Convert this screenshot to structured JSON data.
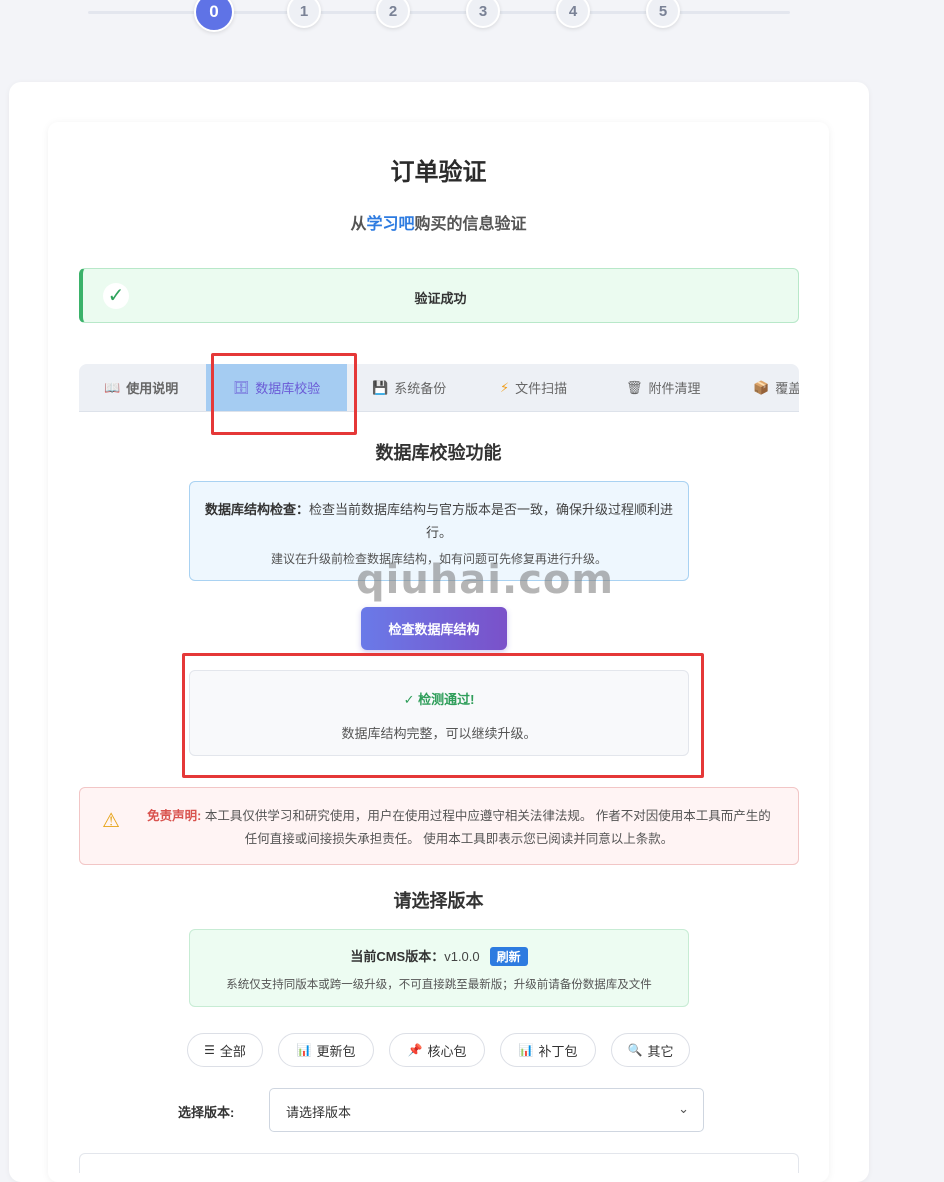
{
  "stepper": {
    "steps": [
      "0",
      "1",
      "2",
      "3",
      "4",
      "5"
    ],
    "active": 0
  },
  "header": {
    "title": "订单验证",
    "subtitle_prefix": "从",
    "subtitle_highlight": "学习吧",
    "subtitle_suffix": "购买的信息验证"
  },
  "success": {
    "icon": "✓",
    "text": "验证成功"
  },
  "tabs": [
    {
      "icon": "📖",
      "label": "使用说明"
    },
    {
      "icon": "🗄",
      "label": "数据库校验"
    },
    {
      "icon": "💾",
      "label": "系统备份"
    },
    {
      "icon": "⚡",
      "label": "文件扫描"
    },
    {
      "icon": "🗑",
      "label": "附件清理"
    },
    {
      "icon": "📦",
      "label": "覆盖"
    }
  ],
  "db_check": {
    "title": "数据库校验功能",
    "info_bold": "数据库结构检查：",
    "info_text": "检查当前数据库结构与官方版本是否一致，确保升级过程顺利进行。",
    "info_note": "建议在升级前检查数据库结构，如有问题可先修复再进行升级。",
    "button": "检查数据库结构",
    "result_title": "✓ 检测通过!",
    "result_text": "数据库结构完整，可以继续升级。"
  },
  "watermark": "qiuhai.com",
  "disclaimer": {
    "icon": "⚠",
    "label": "免责声明:",
    "text": "本工具仅供学习和研究使用，用户在使用过程中应遵守相关法律法规。 作者不对因使用本工具而产生的任何直接或间接损失承担责任。 使用本工具即表示您已阅读并同意以上条款。"
  },
  "version": {
    "title": "请选择版本",
    "current_label": "当前CMS版本：",
    "current_value": "v1.0.0",
    "refresh": "刷新",
    "note": "系统仅支持同版本或跨一级升级，不可直接跳至最新版；升级前请备份数据库及文件"
  },
  "filters": [
    {
      "icon": "☰",
      "label": "全部"
    },
    {
      "icon": "📊",
      "label": "更新包"
    },
    {
      "icon": "📌",
      "label": "核心包"
    },
    {
      "icon": "📊",
      "label": "补丁包"
    },
    {
      "icon": "🔍",
      "label": "其它"
    }
  ],
  "select": {
    "label": "选择版本:",
    "value": "请选择版本",
    "chevron": "⌄"
  }
}
